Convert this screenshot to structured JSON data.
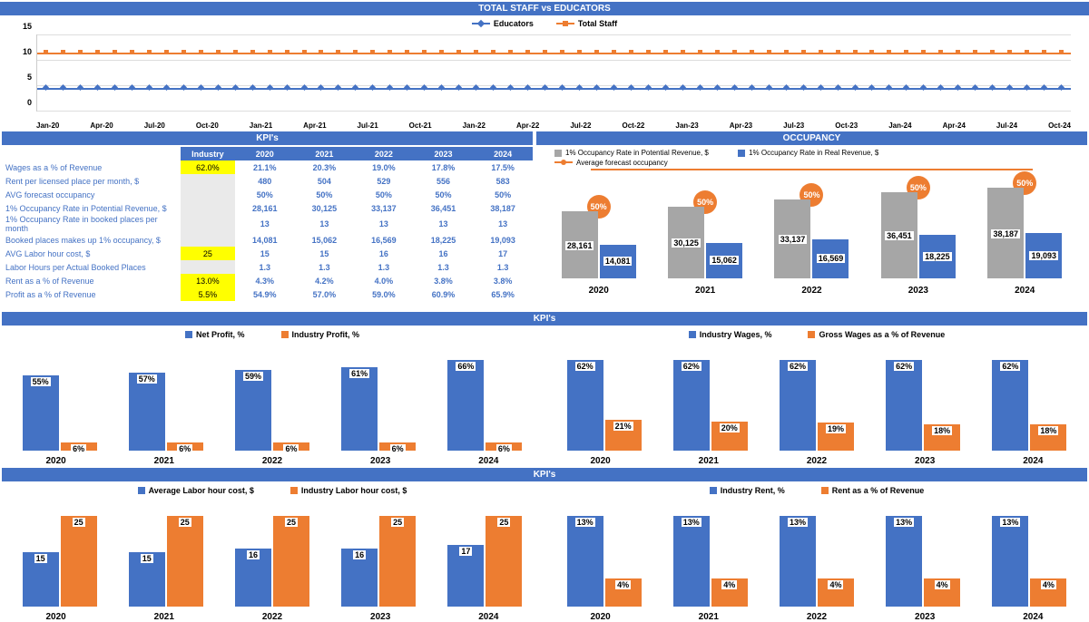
{
  "staff_chart": {
    "title": "TOTAL STAFF vs EDUCATORS",
    "legend": {
      "educators": "Educators",
      "total_staff": "Total Staff"
    },
    "y_ticks": [
      "0",
      "5",
      "10",
      "15"
    ],
    "x_labels": [
      "Jan-20",
      "Apr-20",
      "Jul-20",
      "Oct-20",
      "Jan-21",
      "Apr-21",
      "Jul-21",
      "Oct-21",
      "Jan-22",
      "Apr-22",
      "Jul-22",
      "Oct-22",
      "Jan-23",
      "Apr-23",
      "Jul-23",
      "Oct-23",
      "Jan-24",
      "Apr-24",
      "Jul-24",
      "Oct-24"
    ],
    "educators_value": 5,
    "total_staff_value": 12
  },
  "kpi_table": {
    "title": "KPI's",
    "headers": {
      "industry": "Industry",
      "y1": "2020",
      "y2": "2021",
      "y3": "2022",
      "y4": "2023",
      "y5": "2024"
    },
    "rows": [
      {
        "label": "Wages as a % of Revenue",
        "ind": "62.0%",
        "v": [
          "21.1%",
          "20.3%",
          "19.0%",
          "17.8%",
          "17.5%"
        ]
      },
      {
        "label": "Rent per licensed place per month, $",
        "ind": "",
        "v": [
          "480",
          "504",
          "529",
          "556",
          "583"
        ]
      },
      {
        "label": "AVG forecast occupancy",
        "ind": "",
        "v": [
          "50%",
          "50%",
          "50%",
          "50%",
          "50%"
        ]
      },
      {
        "label": "1% Occupancy Rate in Potential Revenue, $",
        "ind": "",
        "v": [
          "28,161",
          "30,125",
          "33,137",
          "36,451",
          "38,187"
        ]
      },
      {
        "label": "1% Occupancy Rate in booked places per month",
        "ind": "",
        "v": [
          "13",
          "13",
          "13",
          "13",
          "13"
        ]
      },
      {
        "label": "Booked places makes up 1% occupancy, $",
        "ind": "",
        "v": [
          "14,081",
          "15,062",
          "16,569",
          "18,225",
          "19,093"
        ]
      },
      {
        "label": "AVG Labor hour cost, $",
        "ind": "25",
        "v": [
          "15",
          "15",
          "16",
          "16",
          "17"
        ]
      },
      {
        "label": "Labor Hours per Actual Booked Places",
        "ind": "",
        "v": [
          "1.3",
          "1.3",
          "1.3",
          "1.3",
          "1.3"
        ]
      },
      {
        "label": "Rent as a % of Revenue",
        "ind": "13.0%",
        "v": [
          "4.3%",
          "4.2%",
          "4.0%",
          "3.8%",
          "3.8%"
        ]
      },
      {
        "label": "Profit as a % of Revenue",
        "ind": "5.5%",
        "v": [
          "54.9%",
          "57.0%",
          "59.0%",
          "60.9%",
          "65.9%"
        ]
      }
    ]
  },
  "occupancy": {
    "title": "OCCUPANCY",
    "legend": {
      "potential": "1% Occupancy Rate in Potential Revenue, $",
      "real": "1% Occupancy Rate in Real Revenue, $",
      "forecast": "Average forecast occupancy"
    },
    "years": [
      "2020",
      "2021",
      "2022",
      "2023",
      "2024"
    ],
    "potential": [
      "28,161",
      "30,125",
      "33,137",
      "36,451",
      "38,187"
    ],
    "potential_h": [
      74,
      79,
      87,
      95,
      100
    ],
    "real": [
      "14,081",
      "15,062",
      "16,569",
      "18,225",
      "19,093"
    ],
    "real_h": [
      37,
      39,
      43,
      48,
      50
    ],
    "forecast": [
      "50%",
      "50%",
      "50%",
      "50%",
      "50%"
    ]
  },
  "kpis_mid_title": "KPI's",
  "profit": {
    "legend": {
      "net": "Net Profit, %",
      "ind": "Industry Profit, %"
    },
    "years": [
      "2020",
      "2021",
      "2022",
      "2023",
      "2024"
    ],
    "net": [
      "55%",
      "57%",
      "59%",
      "61%",
      "66%"
    ],
    "net_h": [
      83,
      86,
      89,
      92,
      100
    ],
    "ind": [
      "6%",
      "6%",
      "6%",
      "6%",
      "6%"
    ],
    "ind_h": [
      9,
      9,
      9,
      9,
      9
    ]
  },
  "wages": {
    "legend": {
      "ind": "Industry Wages, %",
      "gross": "Gross Wages as a % of Revenue"
    },
    "years": [
      "2020",
      "2021",
      "2022",
      "2023",
      "2024"
    ],
    "ind": [
      "62%",
      "62%",
      "62%",
      "62%",
      "62%"
    ],
    "ind_h": [
      100,
      100,
      100,
      100,
      100
    ],
    "gross": [
      "21%",
      "20%",
      "19%",
      "18%",
      "18%"
    ],
    "gross_h": [
      34,
      32,
      31,
      29,
      29
    ]
  },
  "kpis_bot_title": "KPI's",
  "labor": {
    "legend": {
      "avg": "Average Labor hour cost, $",
      "ind": "Industry Labor hour cost, $"
    },
    "years": [
      "2020",
      "2021",
      "2022",
      "2023",
      "2024"
    ],
    "avg": [
      "15",
      "15",
      "16",
      "16",
      "17"
    ],
    "avg_h": [
      60,
      60,
      64,
      64,
      68
    ],
    "ind": [
      "25",
      "25",
      "25",
      "25",
      "25"
    ],
    "ind_h": [
      100,
      100,
      100,
      100,
      100
    ]
  },
  "rent": {
    "legend": {
      "ind": "Industry Rent, %",
      "rent": "Rent as a % of Revenue"
    },
    "years": [
      "2020",
      "2021",
      "2022",
      "2023",
      "2024"
    ],
    "ind": [
      "13%",
      "13%",
      "13%",
      "13%",
      "13%"
    ],
    "ind_h": [
      100,
      100,
      100,
      100,
      100
    ],
    "rent": [
      "4%",
      "4%",
      "4%",
      "4%",
      "4%"
    ],
    "rent_h": [
      31,
      31,
      31,
      31,
      31
    ]
  },
  "chart_data": [
    {
      "type": "line",
      "title": "TOTAL STAFF vs EDUCATORS",
      "x": [
        "Jan-20",
        "Feb-20",
        "Mar-20",
        "Apr-20",
        "May-20",
        "Jun-20",
        "Jul-20",
        "Aug-20",
        "Sep-20",
        "Oct-20",
        "Nov-20",
        "Dec-20",
        "Jan-21",
        "Feb-21",
        "Mar-21",
        "Apr-21",
        "May-21",
        "Jun-21",
        "Jul-21",
        "Aug-21",
        "Sep-21",
        "Oct-21",
        "Nov-21",
        "Dec-21",
        "Jan-22",
        "Feb-22",
        "Mar-22",
        "Apr-22",
        "May-22",
        "Jun-22",
        "Jul-22",
        "Aug-22",
        "Sep-22",
        "Oct-22",
        "Nov-22",
        "Dec-22",
        "Jan-23",
        "Feb-23",
        "Mar-23",
        "Apr-23",
        "May-23",
        "Jun-23",
        "Jul-23",
        "Aug-23",
        "Sep-23",
        "Oct-23",
        "Nov-23",
        "Dec-23",
        "Jan-24",
        "Feb-24",
        "Mar-24",
        "Apr-24",
        "May-24",
        "Jun-24",
        "Jul-24",
        "Aug-24",
        "Sep-24",
        "Oct-24",
        "Nov-24",
        "Dec-24"
      ],
      "series": [
        {
          "name": "Educators",
          "values_constant": 5
        },
        {
          "name": "Total Staff",
          "values_constant": 12
        }
      ],
      "ylim": [
        0,
        15
      ]
    },
    {
      "type": "bar",
      "title": "OCCUPANCY",
      "categories": [
        "2020",
        "2021",
        "2022",
        "2023",
        "2024"
      ],
      "series": [
        {
          "name": "1% Occupancy Rate in Potential Revenue, $",
          "values": [
            28161,
            30125,
            33137,
            36451,
            38187
          ]
        },
        {
          "name": "1% Occupancy Rate in Real Revenue, $",
          "values": [
            14081,
            15062,
            16569,
            18225,
            19093
          ]
        },
        {
          "name": "Average forecast occupancy",
          "values": [
            0.5,
            0.5,
            0.5,
            0.5,
            0.5
          ],
          "type": "line"
        }
      ]
    },
    {
      "type": "bar",
      "title": "KPI's Profit",
      "categories": [
        "2020",
        "2021",
        "2022",
        "2023",
        "2024"
      ],
      "series": [
        {
          "name": "Net Profit, %",
          "values": [
            55,
            57,
            59,
            61,
            66
          ]
        },
        {
          "name": "Industry Profit, %",
          "values": [
            6,
            6,
            6,
            6,
            6
          ]
        }
      ]
    },
    {
      "type": "bar",
      "title": "KPI's Wages",
      "categories": [
        "2020",
        "2021",
        "2022",
        "2023",
        "2024"
      ],
      "series": [
        {
          "name": "Industry Wages, %",
          "values": [
            62,
            62,
            62,
            62,
            62
          ]
        },
        {
          "name": "Gross Wages as a % of Revenue",
          "values": [
            21,
            20,
            19,
            18,
            18
          ]
        }
      ]
    },
    {
      "type": "bar",
      "title": "KPI's Labor hour cost",
      "categories": [
        "2020",
        "2021",
        "2022",
        "2023",
        "2024"
      ],
      "series": [
        {
          "name": "Average Labor hour cost, $",
          "values": [
            15,
            15,
            16,
            16,
            17
          ]
        },
        {
          "name": "Industry Labor hour cost, $",
          "values": [
            25,
            25,
            25,
            25,
            25
          ]
        }
      ]
    },
    {
      "type": "bar",
      "title": "KPI's Rent",
      "categories": [
        "2020",
        "2021",
        "2022",
        "2023",
        "2024"
      ],
      "series": [
        {
          "name": "Industry Rent, %",
          "values": [
            13,
            13,
            13,
            13,
            13
          ]
        },
        {
          "name": "Rent as a % of Revenue",
          "values": [
            4,
            4,
            4,
            4,
            4
          ]
        }
      ]
    }
  ]
}
